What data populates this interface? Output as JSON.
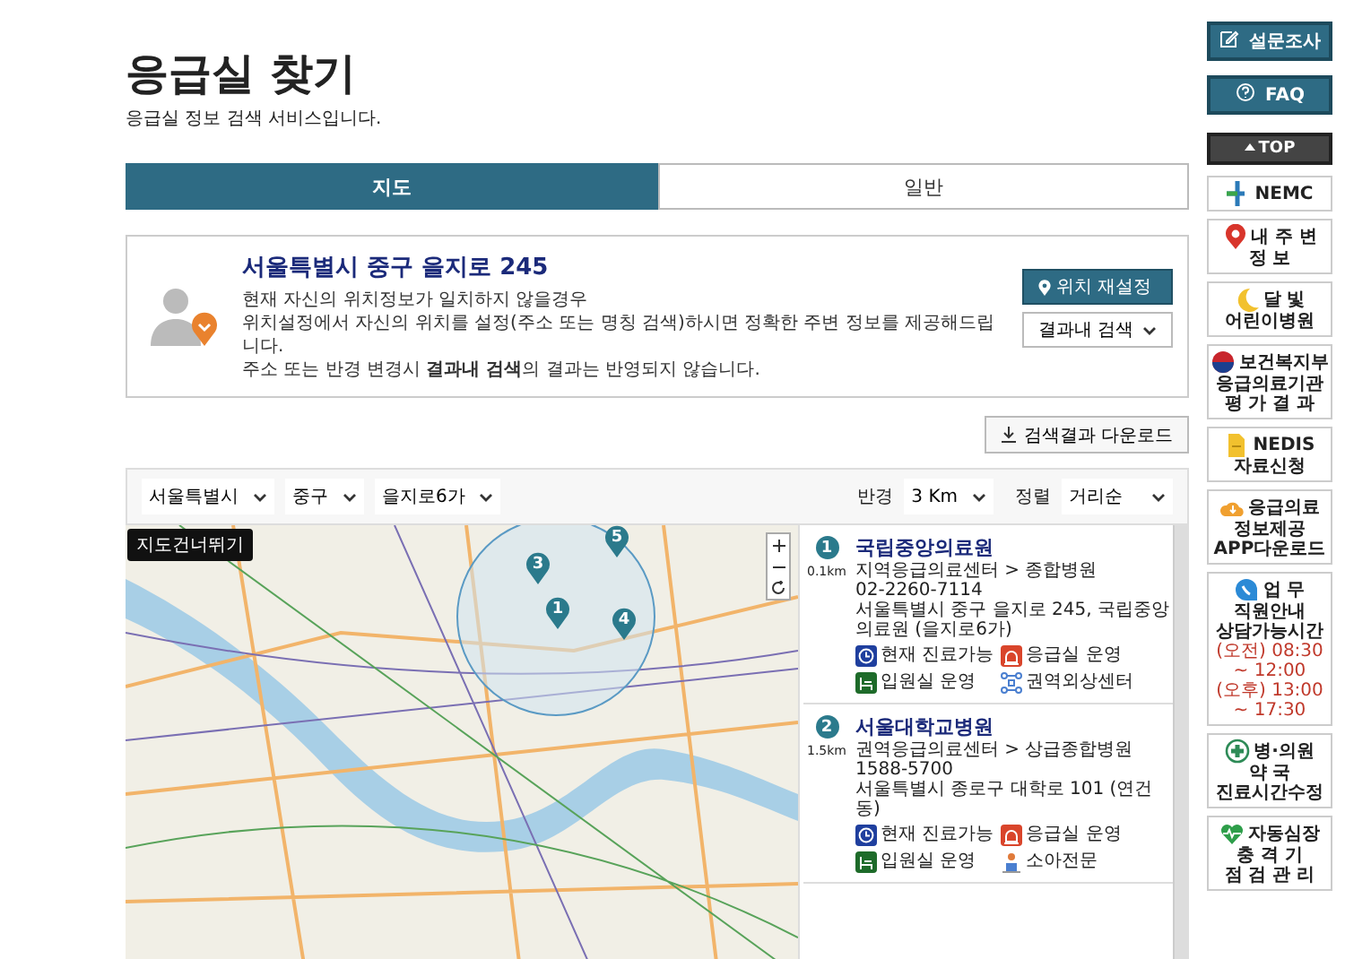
{
  "header": {
    "title": "응급실 찾기",
    "subtitle": "응급실 정보 검색 서비스입니다."
  },
  "tabs": [
    {
      "label": "지도",
      "selected": true
    },
    {
      "label": "일반",
      "selected": false
    }
  ],
  "location": {
    "address": "서울특별시 중구 을지로 245",
    "notice": [
      "현재 자신의 위치정보가 일치하지 않을경우",
      "위치설정에서 자신의 위치를 설정(주소 또는 명칭 검색)하시면 정확한 주변 정보를 제공해드립니다.",
      "주소 또는 반경 변경시 **결과내 검색**의 결과는 반영되지 않습니다."
    ],
    "reset_button": "위치 재설정",
    "filter_button": "결과내 검색"
  },
  "download_button": "검색결과 다운로드",
  "filters": {
    "selects": [
      "서울특별시",
      "중구",
      "을지로6가"
    ],
    "radius_label": "반경",
    "radius": "3 Km",
    "sort_label": "정렬",
    "sort": "거리순"
  },
  "map": {
    "skip_link": "지도건너뛰기",
    "markers": [
      "3",
      "1",
      "4",
      "5"
    ]
  },
  "hospitals": [
    {
      "number": "1",
      "distance": "0.1km",
      "name": "국립중앙의료원",
      "category": "지역응급의료센터 > 종합병원",
      "phone": "02-2260-7114",
      "address": "서울특별시 중구 을지로 245, 국립중앙의료원 (을지로6가)",
      "badges": [
        {
          "kind": "clock",
          "label": "현재 진료가능"
        },
        {
          "kind": "emergency",
          "label": "응급실 운영"
        },
        {
          "kind": "bed",
          "label": "입원실 운영"
        },
        {
          "kind": "trauma",
          "label": "권역외상센터"
        }
      ]
    },
    {
      "number": "2",
      "distance": "1.5km",
      "name": "서울대학교병원",
      "category": "권역응급의료센터 > 상급종합병원",
      "phone": "1588-5700",
      "address": "서울특별시 종로구 대학로 101 (연건동)",
      "badges": [
        {
          "kind": "clock",
          "label": "현재 진료가능"
        },
        {
          "kind": "emergency",
          "label": "응급실 운영"
        },
        {
          "kind": "bed",
          "label": "입원실 운영"
        },
        {
          "kind": "child",
          "label": "소아전문"
        }
      ]
    }
  ],
  "sidebar": [
    {
      "kind": "button",
      "label": "설문조사"
    },
    {
      "kind": "button",
      "label": "FAQ"
    },
    {
      "kind": "top",
      "label": "TOP"
    },
    {
      "kind": "tile",
      "lines": [
        "NEMC"
      ]
    },
    {
      "kind": "tile",
      "lines": [
        "내 주 변",
        "정 보"
      ]
    },
    {
      "kind": "tile",
      "lines": [
        "달 빛",
        "어린이병원"
      ]
    },
    {
      "kind": "tile",
      "lines": [
        "보건복지부",
        "응급의료기관",
        "평 가 결 과"
      ]
    },
    {
      "kind": "tile",
      "lines": [
        "NEDIS",
        "자료신청"
      ]
    },
    {
      "kind": "tile",
      "lines": [
        "응급의료",
        "정보제공",
        "APP다운로드"
      ]
    },
    {
      "kind": "tile",
      "lines": [
        "업 무",
        "직원안내",
        "상담가능시간",
        "(오전) 08:30 ~ 12:00",
        "(오후) 13:00 ~ 17:30"
      ]
    },
    {
      "kind": "tile",
      "lines": [
        "병·의원",
        "약 국",
        "진료시간수정"
      ]
    },
    {
      "kind": "tile",
      "lines": [
        "자동심장",
        "충 격 기",
        "점 검 관 리"
      ]
    }
  ]
}
